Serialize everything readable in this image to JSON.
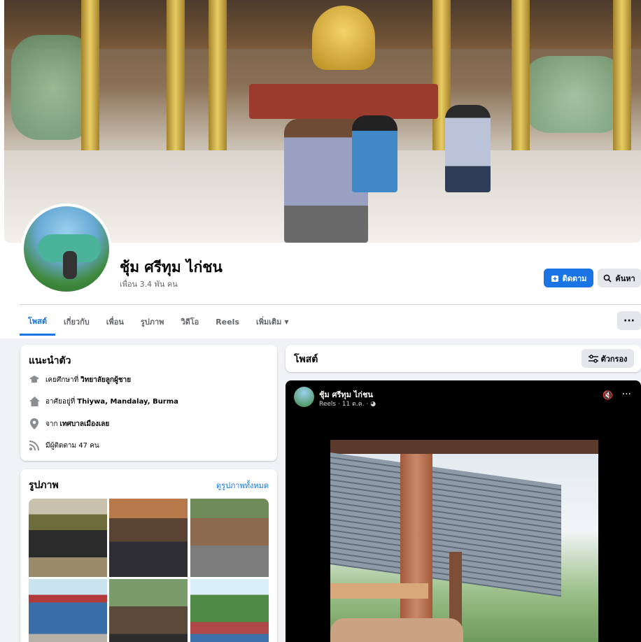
{
  "profile": {
    "name": "ชุ้ม ศรีทุม ไก่ชน",
    "friends": "เพื่อน 3.4 พัน คน"
  },
  "actions": {
    "follow_label": "ติดตาม",
    "search_label": "ค้นหา",
    "more_label": "···"
  },
  "tabs": [
    {
      "label": "โพสต์",
      "active": true
    },
    {
      "label": "เกี่ยวกับ",
      "active": false
    },
    {
      "label": "เพื่อน",
      "active": false
    },
    {
      "label": "รูปภาพ",
      "active": false
    },
    {
      "label": "วิดีโอ",
      "active": false
    },
    {
      "label": "Reels",
      "active": false
    },
    {
      "label": "เพิ่มเติม",
      "active": false
    }
  ],
  "intro": {
    "title": "แนะนำตัว",
    "studied_prefix": "เคยศึกษาที่",
    "studied": "วิทยาลัยลูกผู้ชาย",
    "lives_prefix": "อาศัยอยู่ที่",
    "lives": "Thiywa, Mandalay, Burma",
    "from_prefix": "จาก",
    "from": "เทศบาลเมืองเลย",
    "followers": "มีผู้ติดตาม 47 คน"
  },
  "photos": {
    "title": "รูปภาพ",
    "see_all": "ดูรูปภาพทั้งหมด"
  },
  "posts": {
    "title": "โพสต์",
    "filter_label": "ตัวกรอง"
  },
  "reel": {
    "author": "ชุ้ม ศรีทุม ไก่ชน",
    "meta": "Reels · 11 ต.ค. ·"
  },
  "colors": {
    "accent": "#1b74e4",
    "page_bg": "#f0f2f5",
    "card_bg": "#ffffff",
    "secondary_btn": "#e4e6eb"
  }
}
